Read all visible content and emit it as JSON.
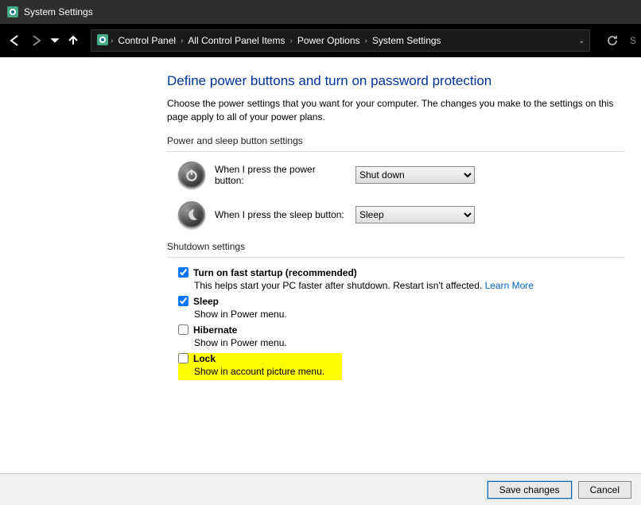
{
  "window": {
    "title": "System Settings"
  },
  "breadcrumb": {
    "items": [
      "Control Panel",
      "All Control Panel Items",
      "Power Options",
      "System Settings"
    ]
  },
  "page": {
    "heading": "Define power buttons and turn on password protection",
    "description": "Choose the power settings that you want for your computer. The changes you make to the settings on this page apply to all of your power plans."
  },
  "section1": {
    "title": "Power and sleep button settings",
    "rows": [
      {
        "label": "When I press the power button:",
        "value": "Shut down"
      },
      {
        "label": "When I press the sleep button:",
        "value": "Sleep"
      }
    ]
  },
  "section2": {
    "title": "Shutdown settings",
    "items": [
      {
        "checked": true,
        "label": "Turn on fast startup (recommended)",
        "sub": "This helps start your PC faster after shutdown. Restart isn't affected. ",
        "link": "Learn More"
      },
      {
        "checked": true,
        "label": "Sleep",
        "sub": "Show in Power menu."
      },
      {
        "checked": false,
        "label": "Hibernate",
        "sub": "Show in Power menu."
      },
      {
        "checked": false,
        "label": "Lock",
        "sub": "Show in account picture menu.",
        "highlight": true
      }
    ]
  },
  "buttons": {
    "save": "Save changes",
    "cancel": "Cancel"
  }
}
